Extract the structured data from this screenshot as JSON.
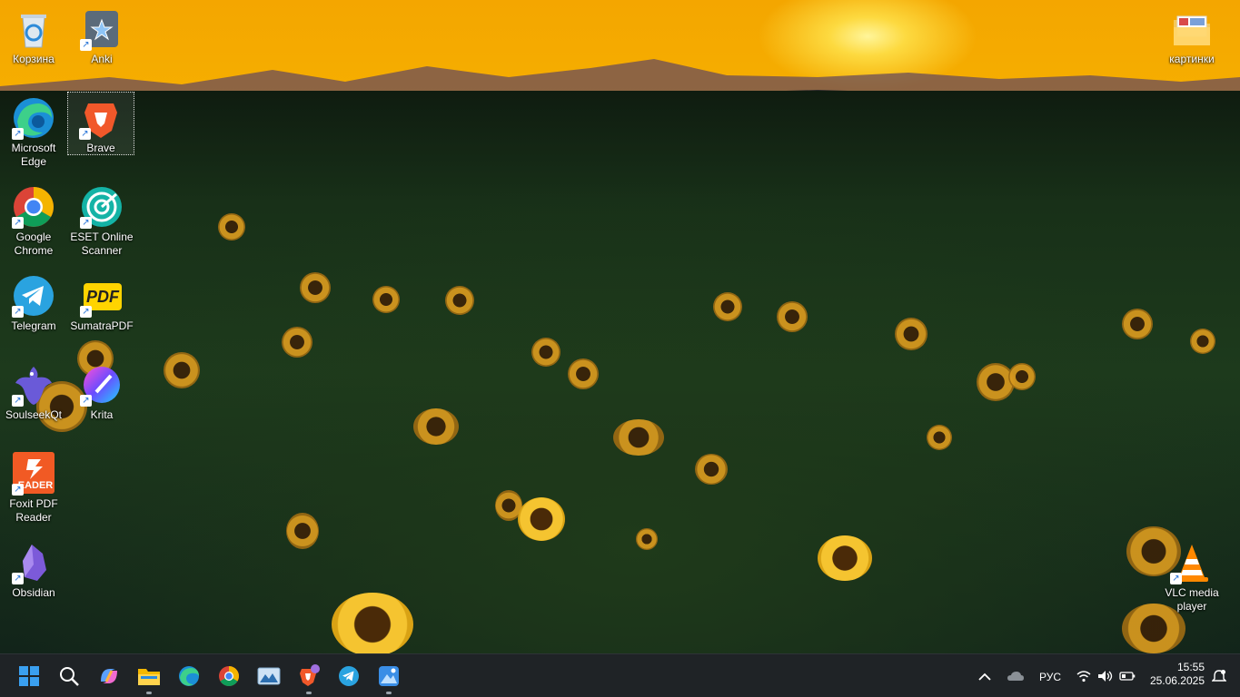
{
  "desktop": {
    "icons": [
      {
        "label": "Корзина",
        "icon": "recycle-bin-icon"
      },
      {
        "label": "Anki",
        "icon": "anki-icon"
      },
      {
        "label": "картинки",
        "icon": "folder-icon"
      },
      {
        "label": "Microsoft Edge",
        "icon": "edge-icon"
      },
      {
        "label": "Brave",
        "icon": "brave-icon"
      },
      {
        "label": "Google Chrome",
        "icon": "chrome-icon"
      },
      {
        "label": "ESET Online Scanner",
        "icon": "eset-icon"
      },
      {
        "label": "Telegram",
        "icon": "telegram-icon"
      },
      {
        "label": "SumatraPDF",
        "icon": "sumatrapdf-icon"
      },
      {
        "label": "SoulseekQt",
        "icon": "soulseek-icon"
      },
      {
        "label": "Krita",
        "icon": "krita-icon"
      },
      {
        "label": "Foxit PDF Reader",
        "icon": "foxit-icon"
      },
      {
        "label": "Obsidian",
        "icon": "obsidian-icon"
      },
      {
        "label": "VLC media player",
        "icon": "vlc-icon"
      }
    ],
    "sumatra_badge": "PDF",
    "foxit_badge": "EADER"
  },
  "taskbar": {
    "apps": [
      {
        "icon": "windows-start-icon"
      },
      {
        "icon": "search-icon"
      },
      {
        "icon": "copilot-icon"
      },
      {
        "icon": "file-explorer-icon"
      },
      {
        "icon": "edge-icon"
      },
      {
        "icon": "chrome-icon"
      },
      {
        "icon": "photos-icon"
      },
      {
        "icon": "brave-icon"
      },
      {
        "icon": "telegram-icon"
      },
      {
        "icon": "image-viewer-icon"
      }
    ],
    "tray": {
      "language": "РУС",
      "time": "15:55",
      "date": "25.06.2025"
    }
  },
  "colors": {
    "taskbar": "#1f2326",
    "sky_top": "#f4a600",
    "accent_blue": "#1f6fd6"
  }
}
